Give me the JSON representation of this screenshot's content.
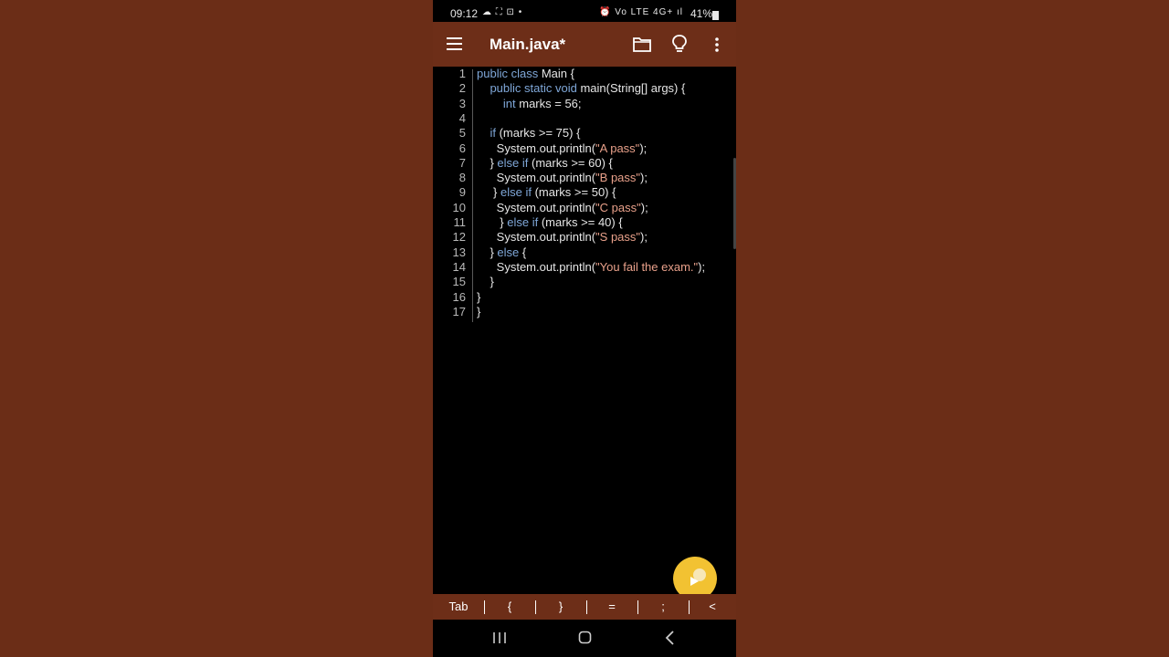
{
  "status_bar": {
    "time": "09:12",
    "left_icons": "☁ ⛶ ⊡ •",
    "right_icons": "⏰ Vo LTE 4G+ ıl",
    "battery": "41%"
  },
  "app_bar": {
    "title": "Main.java*"
  },
  "editor": {
    "lines": [
      {
        "num": "1",
        "segments": [
          {
            "t": "public class ",
            "c": "kw"
          },
          {
            "t": "Main {",
            "c": ""
          }
        ]
      },
      {
        "num": "2",
        "segments": [
          {
            "t": "    public static void ",
            "c": "kw"
          },
          {
            "t": "main(String[] args) {",
            "c": ""
          }
        ]
      },
      {
        "num": "3",
        "segments": [
          {
            "t": "        int ",
            "c": "kw"
          },
          {
            "t": "marks = 56;",
            "c": ""
          }
        ]
      },
      {
        "num": "4",
        "segments": []
      },
      {
        "num": "5",
        "segments": [
          {
            "t": "    if ",
            "c": "kw"
          },
          {
            "t": "(marks >= 75) {",
            "c": ""
          }
        ]
      },
      {
        "num": "6",
        "segments": [
          {
            "t": "      System.out.println(",
            "c": ""
          },
          {
            "t": "\"A pass\"",
            "c": "str"
          },
          {
            "t": ");",
            "c": ""
          }
        ]
      },
      {
        "num": "7",
        "segments": [
          {
            "t": "    } ",
            "c": ""
          },
          {
            "t": "else if ",
            "c": "kw"
          },
          {
            "t": "(marks >= 60) {",
            "c": ""
          }
        ]
      },
      {
        "num": "8",
        "segments": [
          {
            "t": "      System.out.println(",
            "c": ""
          },
          {
            "t": "\"B pass\"",
            "c": "str"
          },
          {
            "t": ");",
            "c": ""
          }
        ]
      },
      {
        "num": "9",
        "segments": [
          {
            "t": "     } ",
            "c": ""
          },
          {
            "t": "else if ",
            "c": "kw"
          },
          {
            "t": "(marks >= 50) {",
            "c": ""
          }
        ]
      },
      {
        "num": "10",
        "segments": [
          {
            "t": "      System.out.println(",
            "c": ""
          },
          {
            "t": "\"C pass\"",
            "c": "str"
          },
          {
            "t": ");",
            "c": ""
          }
        ]
      },
      {
        "num": "11",
        "segments": [
          {
            "t": "       } ",
            "c": ""
          },
          {
            "t": "else if ",
            "c": "kw"
          },
          {
            "t": "(marks >= 40) {",
            "c": ""
          }
        ]
      },
      {
        "num": "12",
        "segments": [
          {
            "t": "      System.out.println(",
            "c": ""
          },
          {
            "t": "\"S pass\"",
            "c": "str"
          },
          {
            "t": ");",
            "c": ""
          }
        ]
      },
      {
        "num": "13",
        "segments": [
          {
            "t": "    } ",
            "c": ""
          },
          {
            "t": "else ",
            "c": "kw"
          },
          {
            "t": "{",
            "c": ""
          }
        ]
      },
      {
        "num": "14",
        "segments": [
          {
            "t": "      System.out.println(",
            "c": ""
          },
          {
            "t": "\"You fail the exam.\"",
            "c": "str"
          },
          {
            "t": ");",
            "c": ""
          }
        ]
      },
      {
        "num": "15",
        "segments": [
          {
            "t": "    }",
            "c": ""
          }
        ]
      },
      {
        "num": "16",
        "segments": [
          {
            "t": "}",
            "c": ""
          }
        ]
      },
      {
        "num": "17",
        "segments": [
          {
            "t": "}",
            "c": ""
          }
        ]
      }
    ]
  },
  "toolbar": {
    "buttons": [
      "Tab",
      "{",
      "}",
      "=",
      ";",
      "<"
    ]
  },
  "colors": {
    "app_bar": "#6d2e18",
    "background": "#6b2d17",
    "keyword": "#7fa7d8",
    "string": "#e8a08a",
    "fab": "#f2c232"
  },
  "icons": {
    "menu": "menu-icon",
    "folder": "folder-icon",
    "bulb": "lightbulb-icon",
    "more": "more-vert-icon",
    "fab": "run-icon",
    "nav_recents": "recents-icon",
    "nav_home": "home-icon",
    "nav_back": "back-icon"
  }
}
